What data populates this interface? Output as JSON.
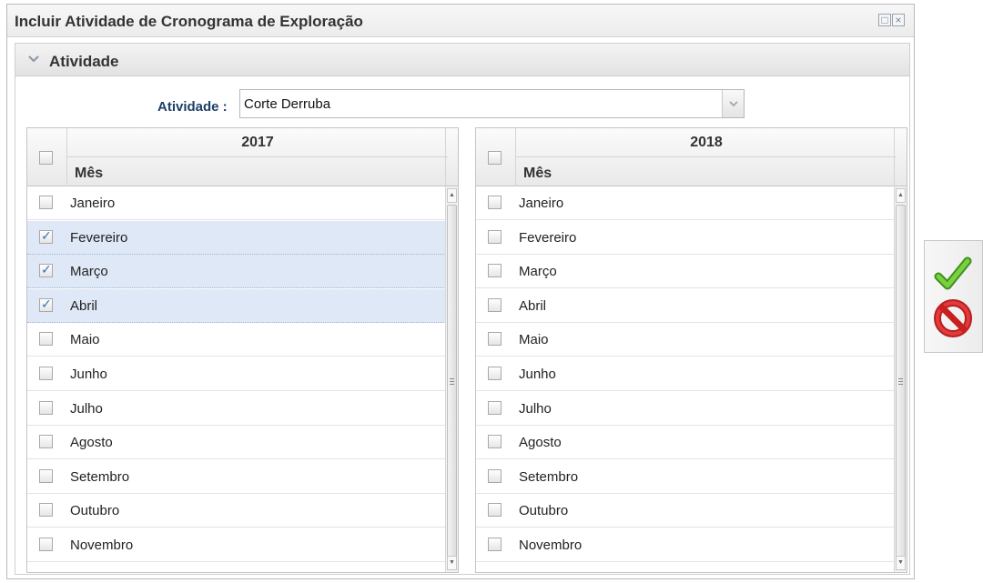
{
  "window": {
    "title": "Incluir Atividade de Cronograma de Exploração"
  },
  "section": {
    "title": "Atividade"
  },
  "form": {
    "atividade_label": "Atividade :",
    "atividade_value": "Corte Derruba"
  },
  "grids": [
    {
      "year": "2017",
      "column_header": "Mês",
      "rows": [
        {
          "label": "Janeiro",
          "checked": false
        },
        {
          "label": "Fevereiro",
          "checked": true
        },
        {
          "label": "Março",
          "checked": true
        },
        {
          "label": "Abril",
          "checked": true
        },
        {
          "label": "Maio",
          "checked": false
        },
        {
          "label": "Junho",
          "checked": false
        },
        {
          "label": "Julho",
          "checked": false
        },
        {
          "label": "Agosto",
          "checked": false
        },
        {
          "label": "Setembro",
          "checked": false
        },
        {
          "label": "Outubro",
          "checked": false
        },
        {
          "label": "Novembro",
          "checked": false
        }
      ]
    },
    {
      "year": "2018",
      "column_header": "Mês",
      "rows": [
        {
          "label": "Janeiro",
          "checked": false
        },
        {
          "label": "Fevereiro",
          "checked": false
        },
        {
          "label": "Março",
          "checked": false
        },
        {
          "label": "Abril",
          "checked": false
        },
        {
          "label": "Maio",
          "checked": false
        },
        {
          "label": "Junho",
          "checked": false
        },
        {
          "label": "Julho",
          "checked": false
        },
        {
          "label": "Agosto",
          "checked": false
        },
        {
          "label": "Setembro",
          "checked": false
        },
        {
          "label": "Outubro",
          "checked": false
        },
        {
          "label": "Novembro",
          "checked": false
        }
      ]
    }
  ],
  "icons": {
    "window_maximize": "maximize-icon",
    "window_close": "close-icon",
    "section_toggle": "chevron-down-icon",
    "combo_trigger": "chevron-down-icon",
    "confirm": "check-icon",
    "cancel": "prohibited-icon"
  },
  "colors": {
    "selected_row": "#dfe8f6",
    "label_text": "#1e3f66",
    "confirm": "#5fb82e",
    "cancel": "#d72a2a"
  }
}
